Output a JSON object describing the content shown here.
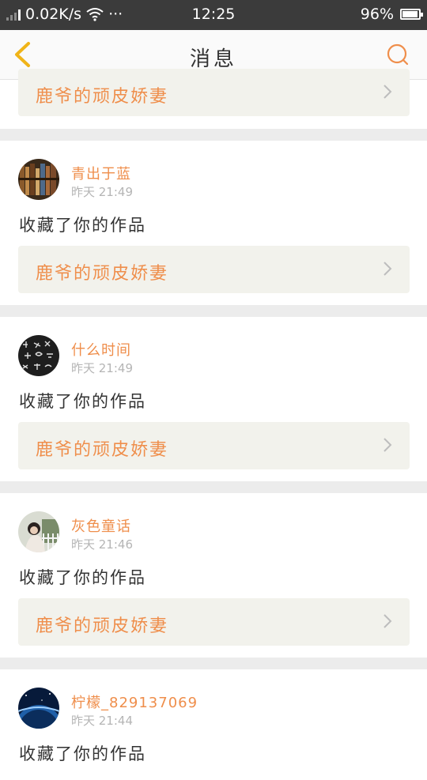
{
  "status_bar": {
    "network_speed": "0.02K/s",
    "dots": "···",
    "time": "12:25",
    "battery_percent": "96%",
    "battery_level": 0.96
  },
  "nav": {
    "title": "消息"
  },
  "top_partial": {
    "work_title": "鹿爷的顽皮娇妻"
  },
  "notifications": [
    {
      "user": "青出于蓝",
      "time": "昨天 21:49",
      "action": "收藏了你的作品",
      "work_title": "鹿爷的顽皮娇妻"
    },
    {
      "user": "什么时间",
      "time": "昨天 21:49",
      "action": "收藏了你的作品",
      "work_title": "鹿爷的顽皮娇妻"
    },
    {
      "user": "灰色童话",
      "time": "昨天 21:46",
      "action": "收藏了你的作品",
      "work_title": "鹿爷的顽皮娇妻"
    },
    {
      "user": "柠檬_829137069",
      "time": "昨天 21:44",
      "action": "收藏了你的作品"
    }
  ],
  "colors": {
    "accent": "#ef8e4b",
    "status_bar": "#3b3b3b",
    "link_bg": "#f2f2ec",
    "back_arrow": "#f0b418"
  }
}
